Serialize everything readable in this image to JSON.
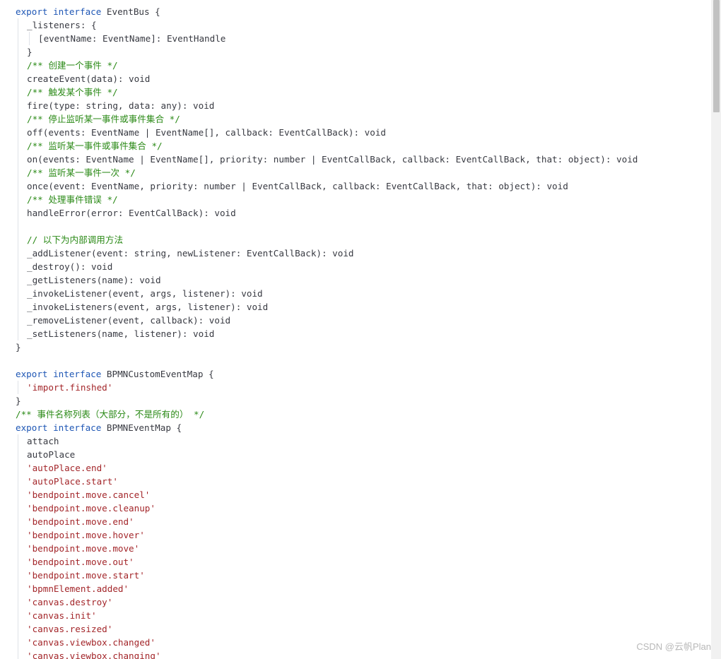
{
  "code_lines": [
    {
      "indent": 0,
      "tokens": [
        {
          "t": "export",
          "c": "kw"
        },
        {
          "t": " "
        },
        {
          "t": "interface",
          "c": "kw"
        },
        {
          "t": " EventBus {"
        }
      ]
    },
    {
      "indent": 1,
      "tokens": [
        {
          "t": "_listeners: {"
        }
      ]
    },
    {
      "indent": 2,
      "tokens": [
        {
          "t": "[eventName: EventName]: EventHandle"
        }
      ]
    },
    {
      "indent": 1,
      "tokens": [
        {
          "t": "}"
        }
      ]
    },
    {
      "indent": 1,
      "tokens": [
        {
          "t": "/** 创建一个事件 */",
          "c": "com"
        }
      ]
    },
    {
      "indent": 1,
      "tokens": [
        {
          "t": "createEvent(data): void"
        }
      ]
    },
    {
      "indent": 1,
      "tokens": [
        {
          "t": "/** 触发某个事件 */",
          "c": "com"
        }
      ]
    },
    {
      "indent": 1,
      "tokens": [
        {
          "t": "fire(type: string, data: any): void"
        }
      ]
    },
    {
      "indent": 1,
      "tokens": [
        {
          "t": "/** 停止监听某一事件或事件集合 */",
          "c": "com"
        }
      ]
    },
    {
      "indent": 1,
      "tokens": [
        {
          "t": "off(events: EventName | EventName[], callback: EventCallBack): void"
        }
      ]
    },
    {
      "indent": 1,
      "tokens": [
        {
          "t": "/** 监听某一事件或事件集合 */",
          "c": "com"
        }
      ]
    },
    {
      "indent": 1,
      "tokens": [
        {
          "t": "on(events: EventName | EventName[], priority: number | EventCallBack, callback: EventCallBack, that: object): void"
        }
      ]
    },
    {
      "indent": 1,
      "tokens": [
        {
          "t": "/** 监听某一事件一次 */",
          "c": "com"
        }
      ]
    },
    {
      "indent": 1,
      "tokens": [
        {
          "t": "once(event: EventName, priority: number | EventCallBack, callback: EventCallBack, that: object): void"
        }
      ]
    },
    {
      "indent": 1,
      "tokens": [
        {
          "t": "/** 处理事件错误 */",
          "c": "com"
        }
      ]
    },
    {
      "indent": 1,
      "tokens": [
        {
          "t": "handleError(error: EventCallBack): void"
        }
      ]
    },
    {
      "indent": 1,
      "tokens": []
    },
    {
      "indent": 1,
      "tokens": [
        {
          "t": "// 以下为内部调用方法",
          "c": "com"
        }
      ]
    },
    {
      "indent": 1,
      "tokens": [
        {
          "t": "_addListener(event: string, newListener: EventCallBack): void"
        }
      ]
    },
    {
      "indent": 1,
      "tokens": [
        {
          "t": "_destroy(): void"
        }
      ]
    },
    {
      "indent": 1,
      "tokens": [
        {
          "t": "_getListeners(name): void"
        }
      ]
    },
    {
      "indent": 1,
      "tokens": [
        {
          "t": "_invokeListener(event, args, listener): void"
        }
      ]
    },
    {
      "indent": 1,
      "tokens": [
        {
          "t": "_invokeListeners(event, args, listener): void"
        }
      ]
    },
    {
      "indent": 1,
      "tokens": [
        {
          "t": "_removeListener(event, callback): void"
        }
      ]
    },
    {
      "indent": 1,
      "tokens": [
        {
          "t": "_setListeners(name, listener): void"
        }
      ]
    },
    {
      "indent": 0,
      "tokens": [
        {
          "t": "}"
        }
      ]
    },
    {
      "indent": 0,
      "tokens": []
    },
    {
      "indent": 0,
      "tokens": [
        {
          "t": "export",
          "c": "kw"
        },
        {
          "t": " "
        },
        {
          "t": "interface",
          "c": "kw"
        },
        {
          "t": " BPMNCustomEventMap {"
        }
      ]
    },
    {
      "indent": 1,
      "tokens": [
        {
          "t": "'import.finshed'",
          "c": "str"
        }
      ]
    },
    {
      "indent": 0,
      "tokens": [
        {
          "t": "}"
        }
      ]
    },
    {
      "indent": 0,
      "tokens": [
        {
          "t": "/** 事件名称列表（大部分，不是所有的） */",
          "c": "com"
        }
      ]
    },
    {
      "indent": 0,
      "tokens": [
        {
          "t": "export",
          "c": "kw"
        },
        {
          "t": " "
        },
        {
          "t": "interface",
          "c": "kw"
        },
        {
          "t": " BPMNEventMap {"
        }
      ]
    },
    {
      "indent": 1,
      "tokens": [
        {
          "t": "attach"
        }
      ]
    },
    {
      "indent": 1,
      "tokens": [
        {
          "t": "autoPlace"
        }
      ]
    },
    {
      "indent": 1,
      "tokens": [
        {
          "t": "'autoPlace.end'",
          "c": "str"
        }
      ]
    },
    {
      "indent": 1,
      "tokens": [
        {
          "t": "'autoPlace.start'",
          "c": "str"
        }
      ]
    },
    {
      "indent": 1,
      "tokens": [
        {
          "t": "'bendpoint.move.cancel'",
          "c": "str"
        }
      ]
    },
    {
      "indent": 1,
      "tokens": [
        {
          "t": "'bendpoint.move.cleanup'",
          "c": "str"
        }
      ]
    },
    {
      "indent": 1,
      "tokens": [
        {
          "t": "'bendpoint.move.end'",
          "c": "str"
        }
      ]
    },
    {
      "indent": 1,
      "tokens": [
        {
          "t": "'bendpoint.move.hover'",
          "c": "str"
        }
      ]
    },
    {
      "indent": 1,
      "tokens": [
        {
          "t": "'bendpoint.move.move'",
          "c": "str"
        }
      ]
    },
    {
      "indent": 1,
      "tokens": [
        {
          "t": "'bendpoint.move.out'",
          "c": "str"
        }
      ]
    },
    {
      "indent": 1,
      "tokens": [
        {
          "t": "'bendpoint.move.start'",
          "c": "str"
        }
      ]
    },
    {
      "indent": 1,
      "tokens": [
        {
          "t": "'bpmnElement.added'",
          "c": "str"
        }
      ]
    },
    {
      "indent": 1,
      "tokens": [
        {
          "t": "'canvas.destroy'",
          "c": "str"
        }
      ]
    },
    {
      "indent": 1,
      "tokens": [
        {
          "t": "'canvas.init'",
          "c": "str"
        }
      ]
    },
    {
      "indent": 1,
      "tokens": [
        {
          "t": "'canvas.resized'",
          "c": "str"
        }
      ]
    },
    {
      "indent": 1,
      "tokens": [
        {
          "t": "'canvas.viewbox.changed'",
          "c": "str"
        }
      ]
    },
    {
      "indent": 1,
      "tokens": [
        {
          "t": "'canvas.viewbox.changing'",
          "c": "str"
        }
      ]
    }
  ],
  "guide_levels": {
    "1": 1,
    "2": 2,
    "3": 1,
    "4": 1,
    "5": 1,
    "6": 1,
    "7": 1,
    "8": 1,
    "9": 1,
    "10": 1,
    "11": 1,
    "12": 1,
    "13": 1,
    "14": 1,
    "15": 1,
    "16": 1,
    "17": 1,
    "18": 1,
    "19": 1,
    "20": 1,
    "21": 1,
    "22": 1,
    "23": 1,
    "24": 1,
    "28": 1,
    "32": 1,
    "33": 1,
    "34": 1,
    "35": 1,
    "36": 1,
    "37": 1,
    "38": 1,
    "39": 1,
    "40": 1,
    "41": 1,
    "42": 1,
    "43": 1,
    "44": 1,
    "45": 1,
    "46": 1,
    "47": 1,
    "48": 1
  },
  "scrollbar": {
    "position": 0.0,
    "visible_fraction": 0.17
  },
  "watermark": "CSDN @云帆Plan",
  "colors": {
    "keyword": "#1f57b5",
    "comment": "#2b8a17",
    "string": "#a3262a",
    "text": "#383a42"
  }
}
